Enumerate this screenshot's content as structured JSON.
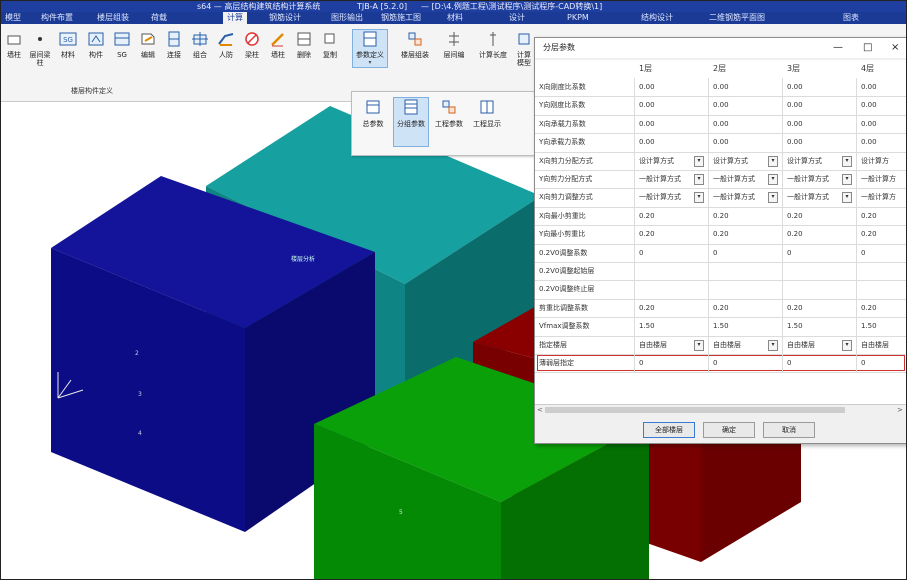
{
  "window": {
    "title": "s64 — 高层结构建筑结构计算系统",
    "version": "TJB-A [5.2.0]",
    "path": "— [D:\\4.例题工程\\测试程序\\测试程序-CAD转换\\1]"
  },
  "menu": {
    "items": [
      "模型",
      "构件布置",
      "楼层组装",
      "荷载",
      "计算",
      "钢筋设计",
      "图形输出",
      "钢筋施工图",
      "材料",
      "设计",
      "PKPM",
      "结构设计",
      "二维钢筋平面图",
      "图表"
    ],
    "active": "计算"
  },
  "ribbon": {
    "buttons": [
      "墙柱",
      "层间梁柱",
      "材料",
      "构件",
      "SG",
      "编辑",
      "连接",
      "组合",
      "人防",
      "梁柱",
      "墙柱",
      "删除",
      "复制",
      "参数定义",
      "楼层组装",
      "层间编",
      "计算长度",
      "计算模型"
    ],
    "group_label": "楼层构件定义",
    "selected": "参数定义"
  },
  "subpanel": {
    "buttons": [
      "总参数",
      "分组参数",
      "工程参数",
      "工程显示"
    ],
    "selected": "分组参数"
  },
  "model": {
    "labels": [
      "楼层分析",
      "2",
      "3",
      "4",
      "5"
    ],
    "colors": {
      "teal": "#0f7f7f",
      "navy": "#0c0c87",
      "red": "#8a0000",
      "green": "#058a05"
    }
  },
  "dialog": {
    "title": "分层参数",
    "controls": {
      "minimize": "—",
      "maximize": "□",
      "close": "×"
    },
    "columns": [
      "1层",
      "2层",
      "3层",
      "4层"
    ],
    "rows": [
      {
        "label": "X向刚度比系数",
        "values": [
          "0.00",
          "0.00",
          "0.00",
          "0.00"
        ]
      },
      {
        "label": "Y向刚度比系数",
        "values": [
          "0.00",
          "0.00",
          "0.00",
          "0.00"
        ]
      },
      {
        "label": "X向承载力系数",
        "values": [
          "0.00",
          "0.00",
          "0.00",
          "0.00"
        ]
      },
      {
        "label": "Y向承载力系数",
        "values": [
          "0.00",
          "0.00",
          "0.00",
          "0.00"
        ]
      },
      {
        "label": "X向剪力分配方式",
        "values": [
          "设计算方式",
          "设计算方式",
          "设计算方式",
          "设计算方"
        ],
        "dropdown": true
      },
      {
        "label": "Y向剪力分配方式",
        "values": [
          "一般计算方式",
          "一般计算方式",
          "一般计算方式",
          "一般计算方"
        ],
        "dropdown": true
      },
      {
        "label": "X向剪力调整方式",
        "values": [
          "一般计算方式",
          "一般计算方式",
          "一般计算方式",
          "一般计算方"
        ],
        "dropdown": true
      },
      {
        "label": "X向最小剪重比",
        "values": [
          "0.20",
          "0.20",
          "0.20",
          "0.20"
        ]
      },
      {
        "label": "Y向最小剪重比",
        "values": [
          "0.20",
          "0.20",
          "0.20",
          "0.20"
        ]
      },
      {
        "label": "0.2V0调整系数",
        "values": [
          "0",
          "0",
          "0",
          "0"
        ]
      },
      {
        "label": "0.2V0调整起始层",
        "values": [
          "",
          "",
          "",
          ""
        ]
      },
      {
        "label": "0.2V0调整终止层",
        "values": [
          "",
          "",
          "",
          ""
        ]
      },
      {
        "label": "剪重比调整系数",
        "values": [
          "0.20",
          "0.20",
          "0.20",
          "0.20"
        ]
      },
      {
        "label": "Vfmax调整系数",
        "values": [
          "1.50",
          "1.50",
          "1.50",
          "1.50"
        ]
      },
      {
        "label": "指定楼层",
        "values": [
          "自由楼层",
          "自由楼层",
          "自由楼层",
          "自由楼层"
        ],
        "dropdown": true
      },
      {
        "label": "薄弱层指定",
        "values": [
          "0",
          "0",
          "0",
          "0"
        ],
        "highlight": true
      }
    ],
    "buttons": {
      "all": "全部楼层",
      "ok": "确定",
      "cancel": "取消"
    },
    "scroll": {
      "left": "<",
      "right": ">"
    }
  }
}
